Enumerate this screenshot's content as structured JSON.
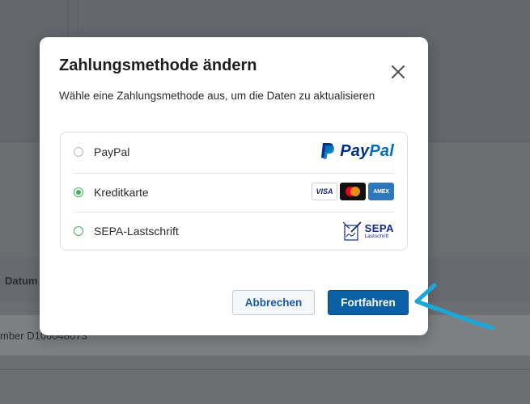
{
  "background": {
    "table_header": "Datum",
    "row_text": "mber D100048073"
  },
  "modal": {
    "title": "Zahlungsmethode ändern",
    "subtitle": "Wähle eine Zahlungsmethode aus, um die Daten zu aktualisieren",
    "options": [
      {
        "label": "PayPal",
        "selected": false,
        "logo": "paypal-logo"
      },
      {
        "label": "Kreditkarte",
        "selected": true,
        "logo": "credit-card-logos"
      },
      {
        "label": "SEPA-Lastschrift",
        "selected": false,
        "logo": "sepa-logo"
      }
    ],
    "logos": {
      "paypal_pay": "Pay",
      "paypal_pal": "Pal",
      "visa": "VISA",
      "amex": "AMEX",
      "sepa": "SEPA",
      "sepa_sub": "Lastschrift"
    },
    "cancel_label": "Abbrechen",
    "continue_label": "Fortfahren"
  },
  "colors": {
    "accent_green": "#3db35e",
    "primary_blue": "#0b5fa5",
    "arrow_cyan": "#1aa8d8"
  }
}
